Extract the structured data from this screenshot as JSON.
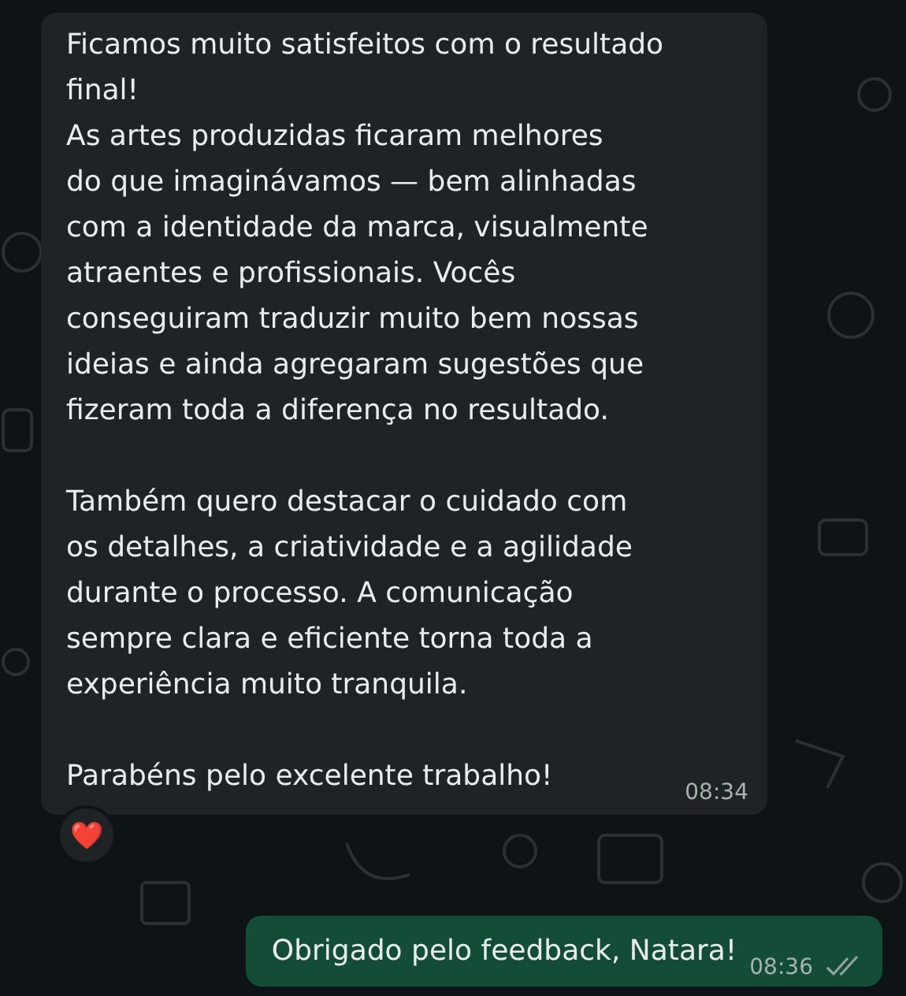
{
  "messages": [
    {
      "kind": "incoming",
      "paragraphs": [
        "Ficamos muito satisfeitos com o resultado\nfinal!\nAs artes produzidas ficaram melhores\ndo que imaginávamos — bem alinhadas\ncom a identidade da marca, visualmente\natraentes e profissionais. Vocês\nconseguiram traduzir muito bem nossas\nideias e ainda agregaram sugestões que\nfizeram toda a diferença no resultado.",
        "Também quero destacar o cuidado com\nos detalhes, a criatividade e a agilidade\ndurante o processo. A comunicação\nsempre clara e eficiente torna toda a\nexperiência muito tranquila.",
        "Parabéns pelo excelente trabalho!"
      ],
      "time": "08:34",
      "reaction": "❤️"
    },
    {
      "kind": "outgoing",
      "paragraphs": [
        "Obrigado pelo feedback, Natara!"
      ],
      "time": "08:36",
      "read": false
    }
  ]
}
